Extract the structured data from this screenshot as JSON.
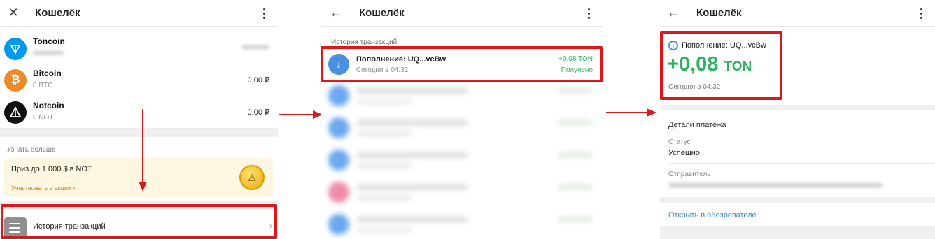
{
  "panel1": {
    "title": "Кошелёк",
    "coins": [
      {
        "name": "Toncoin",
        "amount": "",
        "value": ""
      },
      {
        "name": "Bitcoin",
        "amount": "0 BTC",
        "value": "0,00 ₽"
      },
      {
        "name": "Notcoin",
        "amount": "0 NOT",
        "value": "0,00 ₽"
      }
    ],
    "section_label": "Узнать больше",
    "promo": {
      "title": "Приз до 1 000 $ в NOT",
      "link": "Участвовать в акции"
    },
    "history_label": "История транзакций"
  },
  "panel2": {
    "title": "Кошелёк",
    "section_label": "История транзакций",
    "tx": {
      "title": "Пополнение: UQ...vcBw",
      "time": "Сегодня в 04:32",
      "amount": "+0,08 TON",
      "status": "Получено"
    }
  },
  "panel3": {
    "title": "Кошелёк",
    "sub": "Пополнение: UQ...vcBw",
    "amount": "+0,08",
    "currency": "TON",
    "time": "Сегодня в 04:32",
    "details_label": "Детали платежа",
    "status_key": "Статус",
    "status_value": "Успешно",
    "sender_key": "Отправитель",
    "link": "Открыть в обозревателе"
  },
  "colors": {
    "accent_red": "#e1161b",
    "green": "#2eb360",
    "blue": "#4a90e2"
  },
  "icons": {
    "close": "close-icon",
    "back": "back-arrow-icon",
    "menu": "more-vert-icon"
  }
}
